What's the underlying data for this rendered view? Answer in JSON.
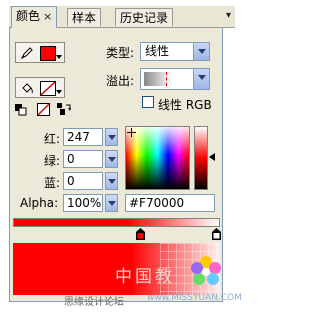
{
  "tabs": [
    {
      "label": "颜色",
      "close": "×"
    },
    {
      "label": "样本"
    },
    {
      "label": "历史记录"
    }
  ],
  "tab_scroll": "▾",
  "stroke": {
    "icon": "pencil-icon",
    "color": "#ff0000"
  },
  "fill": {
    "icon": "paint-bucket-icon",
    "color": "none"
  },
  "type": {
    "label": "类型:",
    "value": "线性"
  },
  "overflow": {
    "label": "溢出:"
  },
  "linear_rgb": {
    "label": "线性 RGB",
    "checked": false
  },
  "channels": {
    "red": {
      "label": "红:",
      "value": "247"
    },
    "green": {
      "label": "绿:",
      "value": "0"
    },
    "blue": {
      "label": "蓝:",
      "value": "0"
    },
    "alpha": {
      "label": "Alpha:",
      "value": "100%"
    }
  },
  "hex": "#F70000",
  "gradient": {
    "from": "#ff0000",
    "to": "#ffffff"
  },
  "watermark": {
    "cn": "中国教",
    "bbs": "思缘设计论坛",
    "url": "www.MISSYUAN.COM"
  }
}
